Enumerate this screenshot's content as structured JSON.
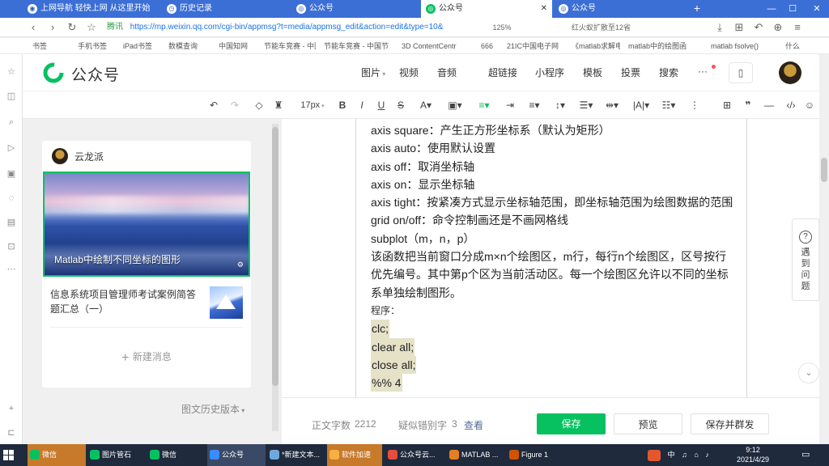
{
  "colors": {
    "accent": "#07c160",
    "tabbar": "#3b6fd6",
    "link": "#576b95"
  },
  "browser": {
    "tabs": [
      {
        "label": "上网导航  轻快上网 从这里开始",
        "icon": "globe-icon",
        "active": false
      },
      {
        "label": "历史记录",
        "icon": "history-icon",
        "active": false
      },
      {
        "label": "公众号",
        "icon": "weixin-icon",
        "active": false
      },
      {
        "label": "公众号",
        "icon": "weixin-icon",
        "active": true
      },
      {
        "label": "公众号",
        "icon": "weixin-icon",
        "active": false
      }
    ],
    "new_tab": "+",
    "site_tag": "腾讯",
    "url": "https://mp.weixin.qq.com/cgi-bin/appmsg?t=media/appmsg_edit&action=edit&type=10&",
    "zoom": "125%",
    "search_hint": "红火蚁扩散至12省",
    "bookmarks": [
      "书签",
      "手机书签",
      "iPad书签",
      "数模查询",
      "中国知网",
      "节能车竞赛 - 中国节",
      "节能车竞赛 - 中国节",
      "3D ContentCentr",
      "666",
      "21IC中国电子网",
      "《matlab求解电路",
      "matlab中的绘图函",
      "matlab fsolve()",
      "什么"
    ]
  },
  "header": {
    "brand": "公众号",
    "menu": [
      "图片",
      "视频",
      "音频",
      "超链接",
      "小程序",
      "模板",
      "投票",
      "搜索",
      "···"
    ]
  },
  "toolbar": {
    "font_size": "17px"
  },
  "left": {
    "account_name": "云龙派",
    "cover_title": "Matlab中绘制不同坐标的图形",
    "item2_title": "信息系统项目管理师考试案例简答题汇总（一）",
    "new_message": "新建消息",
    "history": "图文历史版本"
  },
  "editor": {
    "lines": [
      "axis square：产生正方形坐标系（默认为矩形）",
      "axis auto：使用默认设置",
      "axis off：取消坐标轴",
      "axis on：显示坐标轴",
      "axis tight：按紧凑方式显示坐标轴范围，即坐标轴范围为绘图数据的范围",
      "grid on/off：命令控制画还是不画网格线",
      "subplot（m，n，p）",
      "该函数把当前窗口分成m×n个绘图区，m行，每行n个绘图区，区号按行优先编号。其中第p个区为当前活动区。每一个绘图区允许以不同的坐标系单独绘制图形。"
    ],
    "program_label": "程序：",
    "code": [
      "clc;",
      "clear all;",
      "close all;",
      "%% 4"
    ]
  },
  "help": {
    "label": "遇到问题"
  },
  "status": {
    "word_count_label": "正文字数",
    "word_count": "2212",
    "typo_label": "疑似错别字",
    "typo_count": "3",
    "view": "查看",
    "save": "保存",
    "preview": "预览",
    "save_publish": "保存并群发"
  },
  "taskbar": {
    "items": [
      "微信",
      "图片管石",
      "微信",
      "公众号",
      "*新建文本...",
      "软件加速",
      "公众号云...",
      "MATLAB ...",
      "Figure 1"
    ],
    "ime": "中",
    "time": "9:12",
    "date": "2021/4/29"
  }
}
